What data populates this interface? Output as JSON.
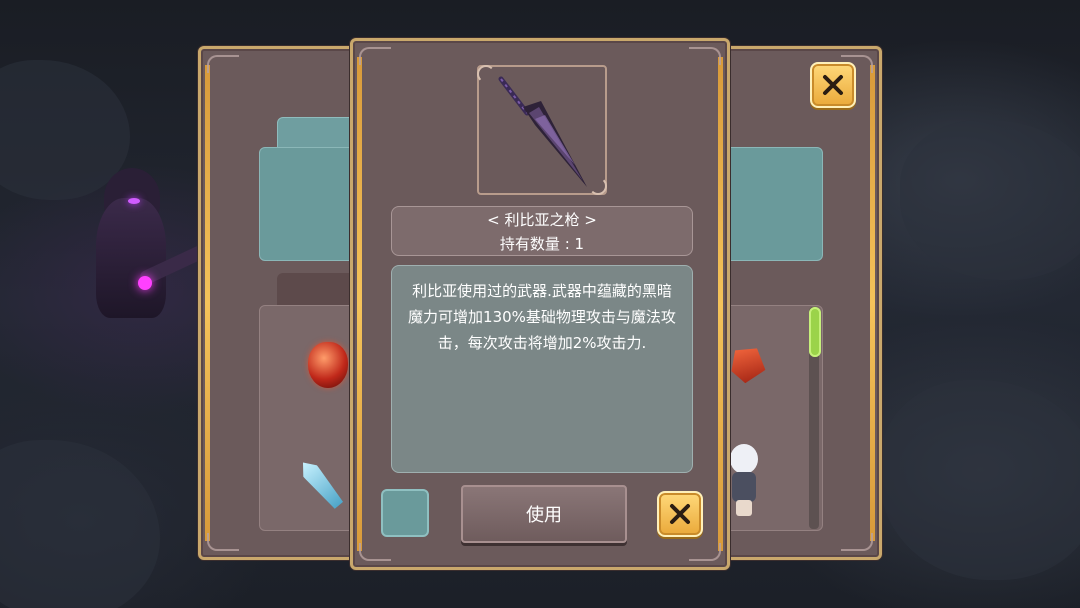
{
  "item": {
    "name": "< 利比亚之枪 >",
    "owned_count": "持有数量 : 1",
    "description": "利比亚使用过的武器.武器中蕴藏的黑暗魔力可增加130%基础物理攻击与魔法攻击，每次攻击将增加2%攻击力.",
    "icon": "dark-spear-icon"
  },
  "actions": {
    "use_label": "使用",
    "close_icon": "close-icon"
  },
  "colors": {
    "panel": "#6b5a5b",
    "panel_border": "#c9a86c",
    "gold_button": "#f5c35a",
    "teal": "#6a9a9b",
    "scrollbar": "#9bd34a"
  }
}
